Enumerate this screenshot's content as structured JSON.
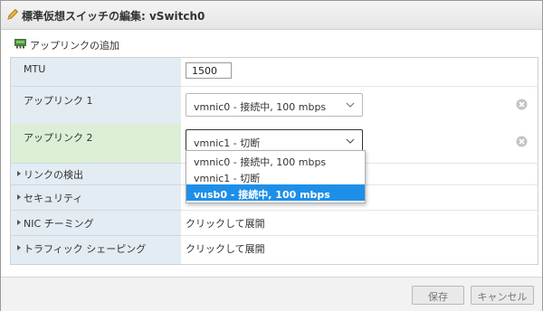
{
  "dialog": {
    "title": "標準仮想スイッチの編集: vSwitch0",
    "add_uplink_label": "アップリンクの追加"
  },
  "rows": {
    "mtu": {
      "label": "MTU",
      "value": "1500"
    },
    "uplink1": {
      "label": "アップリンク 1",
      "selected": "vmnic0 - 接続中, 100 mbps"
    },
    "uplink2": {
      "label": "アップリンク 2",
      "selected": "vmnic1 - 切断"
    },
    "link_detection": {
      "label": "リンクの検出"
    },
    "security": {
      "label": "セキュリティ"
    },
    "nic_teaming": {
      "label": "NIC チーミング",
      "value": "クリックして展開"
    },
    "traffic_shaping": {
      "label": "トラフィック シェーピング",
      "value": "クリックして展開"
    }
  },
  "dropdown": {
    "options": [
      "vmnic0 - 接続中, 100 mbps",
      "vmnic1 - 切断",
      "vusb0 - 接続中, 100 mbps"
    ],
    "highlighted_index": 2
  },
  "footer": {
    "save_label": "保存",
    "cancel_label": "キャンセル"
  },
  "colors": {
    "label_bg": "#e3ecf3",
    "active_label_bg": "#dcefd6",
    "highlight": "#1e8fe8"
  },
  "icons": {
    "title": "pencil-icon",
    "add_uplink": "network-adapter-icon",
    "clear": "clear-circle-icon",
    "expand": "triangle-right-icon",
    "dropdown": "chevron-down-icon"
  }
}
